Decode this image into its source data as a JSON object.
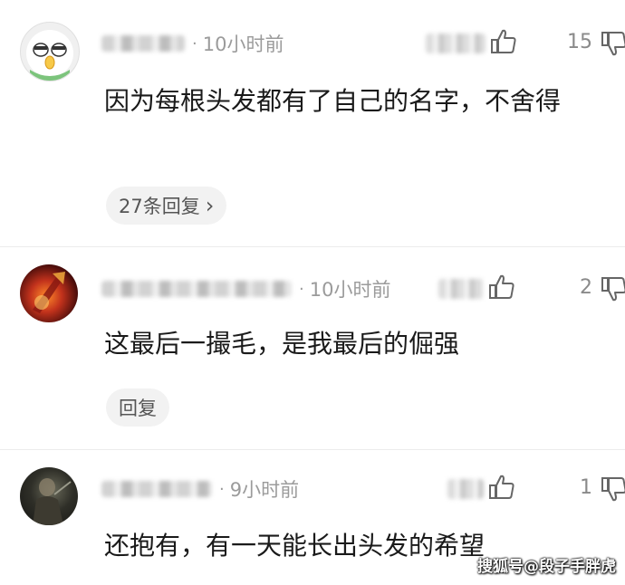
{
  "comments": [
    {
      "time": "10小时前",
      "like_count": "15",
      "text": "因为每根头发都有了自己的名字，不舍得",
      "reply_label": "27条回复",
      "reply_chevron": "›"
    },
    {
      "time": "10小时前",
      "like_count": "2",
      "text": "这最后一撮毛，是我最后的倔强",
      "reply_label": "回复"
    },
    {
      "time": "9小时前",
      "like_count": "1",
      "text": "还抱有，有一天能长出头发的希望"
    }
  ],
  "separator": "·",
  "watermark": "搜狐号@段子手胖虎",
  "colors": {
    "meta": "#9b9b9b",
    "text": "#1a1a1a",
    "reply_bg": "#f2f2f2"
  }
}
